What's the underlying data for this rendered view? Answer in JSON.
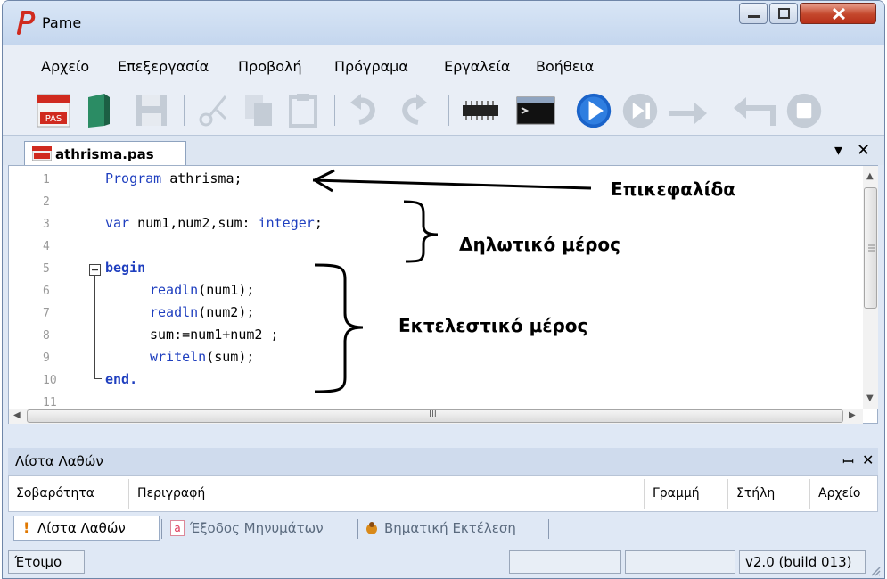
{
  "window": {
    "title": "Pame"
  },
  "menu": [
    "Αρχείο",
    "Επεξεργασία",
    "Προβολή",
    "Πρόγραμα",
    "Εργαλεία",
    "Βοήθεια"
  ],
  "toolbar": {
    "icons": [
      "new-pas-icon",
      "open-icon",
      "save-icon",
      "cut-icon",
      "copy-icon",
      "paste-icon",
      "undo-icon",
      "redo-icon",
      "compile-chip-icon",
      "console-icon",
      "run-icon",
      "step-icon",
      "step-over-icon",
      "step-back-icon",
      "stop-icon"
    ],
    "new_badge": "PAS"
  },
  "tabs": {
    "active": "athrisma.pas",
    "controls": [
      "▾",
      "✕"
    ]
  },
  "editor": {
    "line_numbers": [
      "1",
      "2",
      "3",
      "4",
      "5",
      "6",
      "7",
      "8",
      "9",
      "10",
      "11"
    ],
    "code": [
      {
        "k": "Program",
        "r": " athrisma;"
      },
      {
        "k": "",
        "r": ""
      },
      {
        "k": "var",
        "r": " num1,num2,sum: ",
        "t": "integer",
        "e": ";"
      },
      {
        "k": "",
        "r": ""
      },
      {
        "k": "begin",
        "r": ""
      },
      {
        "f": "readln",
        "r": "(num1);"
      },
      {
        "f": "readln",
        "r": "(num2);"
      },
      {
        "k": "",
        "r": "sum:=num1+num2 ;"
      },
      {
        "f": "writeln",
        "r": "(sum);"
      },
      {
        "k": "end.",
        "r": ""
      },
      {
        "k": "",
        "r": ""
      }
    ],
    "hscroll_mark": "III"
  },
  "annotations": {
    "heading": "Επικεφαλίδα",
    "declarative": "Δηλωτικό μέρος",
    "executive": "Εκτελεστικό μέρος"
  },
  "errors_panel": {
    "title": "Λίστα Λαθών",
    "controls": [
      "ꟷ",
      "✕"
    ],
    "columns": [
      "Σοβαρότητα",
      "Περιγραφή",
      "Γραμμή",
      "Στήλη",
      "Αρχείο"
    ]
  },
  "bottom_tabs": [
    "Λίστα Λαθών",
    "Έξοδος Μηνυμάτων",
    "Βηματική Εκτέλεση"
  ],
  "status": {
    "state": "Έτοιμο",
    "version": "v2.0 (build 013)"
  },
  "colors": {
    "keyword": "#1f3fbf",
    "accent": "#d02a1e",
    "run": "#1a63c9"
  }
}
